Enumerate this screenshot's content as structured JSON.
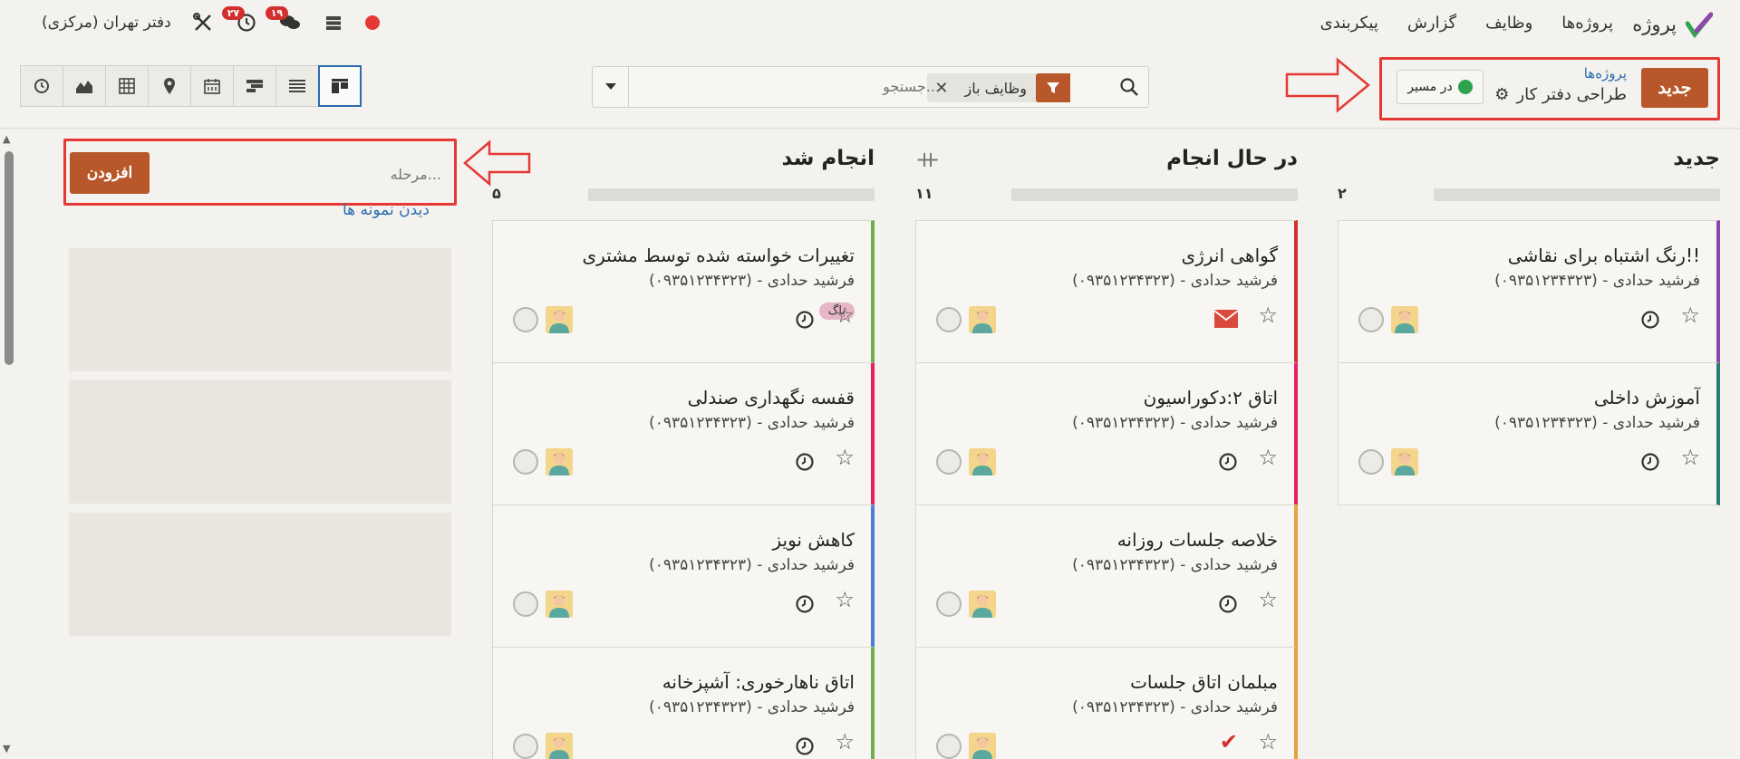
{
  "topbar": {
    "app_name": "پروژه",
    "menu": [
      "پروژه‌ها",
      "وظایف",
      "گزارش",
      "پیکربندی"
    ],
    "company": "دفتر تهران (مرکزی)",
    "activity_count": "۲۷",
    "messages_count": "۱۹",
    "status_color": "#e53935"
  },
  "control_panel": {
    "new_button": "جدید",
    "breadcrumb_root": "پروژه‌ها",
    "breadcrumb_current": "طراحی دفتر کار",
    "status_label": "در مسیر",
    "status_color": "#2ea44f"
  },
  "search": {
    "facet_label": "وظایف باز",
    "placeholder": "جستجو..."
  },
  "views": [
    "kanban",
    "list",
    "gantt",
    "calendar",
    "map",
    "pivot",
    "graph",
    "activity"
  ],
  "columns": [
    {
      "title": "جدید",
      "count": "۲",
      "cards": [
        {
          "title": "رنگ اشتباه برای نقاشی!!",
          "subtitle": "فرشید حدادی - (۰۹۳۵۱۲۳۴۳۲۳)",
          "activity": "clock",
          "color": "#8e44ad"
        },
        {
          "title": "آموزش داخلی",
          "subtitle": "فرشید حدادی - (۰۹۳۵۱۲۳۴۳۲۳)",
          "activity": "clock",
          "color": "#2c7873"
        }
      ]
    },
    {
      "title": "در حال انجام",
      "count": "۱۱",
      "cards": [
        {
          "title": "گواهی انرژی",
          "subtitle": "فرشید حدادی - (۰۹۳۵۱۲۳۴۳۲۳)",
          "activity": "mail",
          "color": "#d32f2f"
        },
        {
          "title": "اتاق ۲:دکوراسیون",
          "subtitle": "فرشید حدادی - (۰۹۳۵۱۲۳۴۳۲۳)",
          "activity": "clock",
          "color": "#e91e63"
        },
        {
          "title": "خلاصه جلسات روزانه",
          "subtitle": "فرشید حدادی - (۰۹۳۵۱۲۳۴۳۲۳)",
          "activity": "clock",
          "color": "#e6a23c"
        },
        {
          "title": "مبلمان اتاق جلسات",
          "subtitle": "فرشید حدادی - (۰۹۳۵۱۲۳۴۳۲۳)",
          "activity": "check",
          "color": "#e6a23c"
        }
      ]
    },
    {
      "title": "انجام شد",
      "count": "۵",
      "cards": [
        {
          "title": "تغییرات خواسته شده توسط مشتری",
          "subtitle": "فرشید حدادی - (۰۹۳۵۱۲۳۴۳۲۳)",
          "tag": "باگ",
          "activity": "clock",
          "color": "#6ab04c"
        },
        {
          "title": "قفسه نگهداری صندلی",
          "subtitle": "فرشید حدادی - (۰۹۳۵۱۲۳۴۳۲۳)",
          "activity": "clock",
          "color": "#e91e63"
        },
        {
          "title": "کاهش نویز",
          "subtitle": "فرشید حدادی - (۰۹۳۵۱۲۳۴۳۲۳)",
          "activity": "clock",
          "color": "#4a7fd4"
        },
        {
          "title": "اتاق ناهارخوری: آشپزخانه",
          "subtitle": "فرشید حدادی - (۰۹۳۵۱۲۳۴۳۲۳)",
          "activity": "clock",
          "color": "#6ab04c"
        }
      ]
    }
  ],
  "add_stage": {
    "placeholder": "مرحله...",
    "button": "افزودن",
    "examples_link": "دیدن نمونه ها"
  }
}
